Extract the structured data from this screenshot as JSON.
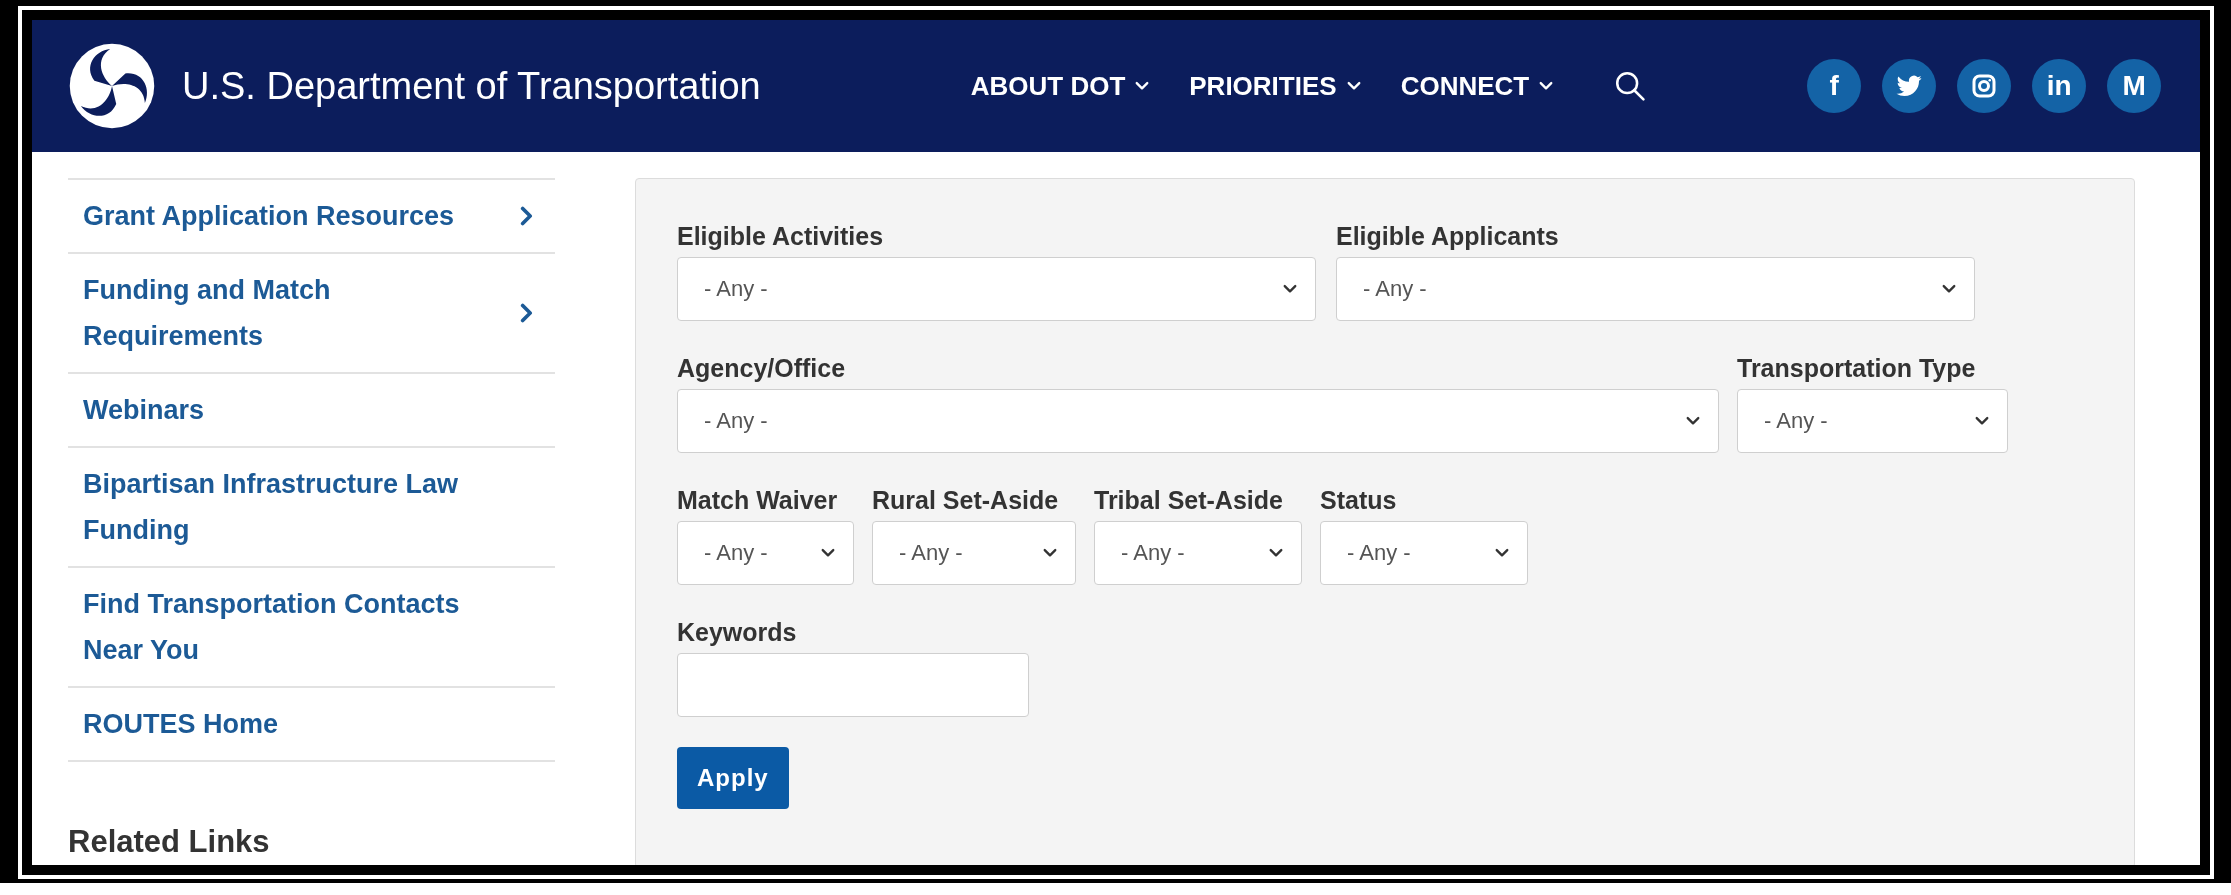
{
  "header": {
    "title": "U.S. Department of Transportation",
    "nav": [
      {
        "label": "ABOUT DOT"
      },
      {
        "label": "PRIORITIES"
      },
      {
        "label": "CONNECT"
      }
    ],
    "social": [
      {
        "kind": "letter",
        "text": "f"
      },
      {
        "kind": "bird"
      },
      {
        "kind": "camera"
      },
      {
        "kind": "letter",
        "text": "in"
      },
      {
        "kind": "letter",
        "text": "M"
      }
    ]
  },
  "sidebar": {
    "items": [
      {
        "label": "Grant Application Resources",
        "has_submenu": true
      },
      {
        "label": "Funding and Match Requirements",
        "has_submenu": true
      },
      {
        "label": "Webinars",
        "has_submenu": false
      },
      {
        "label": "Bipartisan Infrastructure Law Funding",
        "has_submenu": false
      },
      {
        "label": "Find Transportation Contacts Near You",
        "has_submenu": false
      },
      {
        "label": "ROUTES Home",
        "has_submenu": false
      }
    ],
    "related_heading": "Related Links"
  },
  "filters": {
    "rows": [
      {
        "fields": [
          {
            "label": "Eligible Activities",
            "kind": "select",
            "value": "- Any -"
          },
          {
            "label": "Eligible Applicants",
            "kind": "select",
            "value": "- Any -"
          }
        ]
      },
      {
        "fields": [
          {
            "label": "Agency/Office",
            "kind": "select",
            "value": "- Any -"
          },
          {
            "label": "Transportation Type",
            "kind": "select",
            "value": "- Any -"
          }
        ]
      },
      {
        "fields": [
          {
            "label": "Match Waiver",
            "kind": "select",
            "value": "- Any -"
          },
          {
            "label": "Rural Set-Aside",
            "kind": "select",
            "value": "- Any -"
          },
          {
            "label": "Tribal Set-Aside",
            "kind": "select",
            "value": "- Any -"
          },
          {
            "label": "Status",
            "kind": "select",
            "value": "- Any -"
          }
        ]
      },
      {
        "fields": [
          {
            "label": "Keywords",
            "kind": "text"
          }
        ]
      }
    ],
    "apply_button": "Apply"
  }
}
